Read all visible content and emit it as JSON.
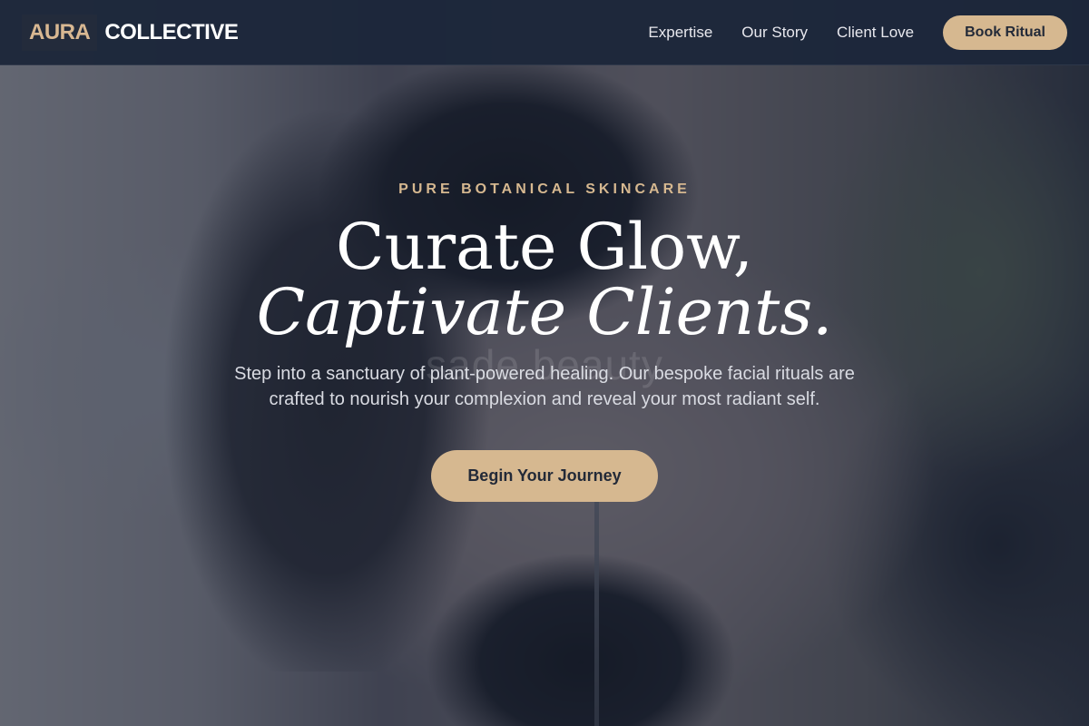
{
  "header": {
    "logo": {
      "part1": "AURA",
      "part2": "COLLECTIVE"
    },
    "nav": [
      {
        "label": "Expertise"
      },
      {
        "label": "Our Story"
      },
      {
        "label": "Client Love"
      }
    ],
    "cta_label": "Book Ritual"
  },
  "hero": {
    "eyebrow": "PURE BOTANICAL SKINCARE",
    "headline_line1": "Curate Glow,",
    "headline_line2": "Captivate Clients.",
    "watermark": "sade beauty",
    "subtext": "Step into a sanctuary of plant-powered healing. Our bespoke facial rituals are crafted to nourish your complexion and reveal your most radiant self.",
    "cta_label": "Begin Your Journey"
  },
  "colors": {
    "accent": "#d6b890",
    "header_bg": "#1c263a",
    "text_light": "#ffffff"
  }
}
